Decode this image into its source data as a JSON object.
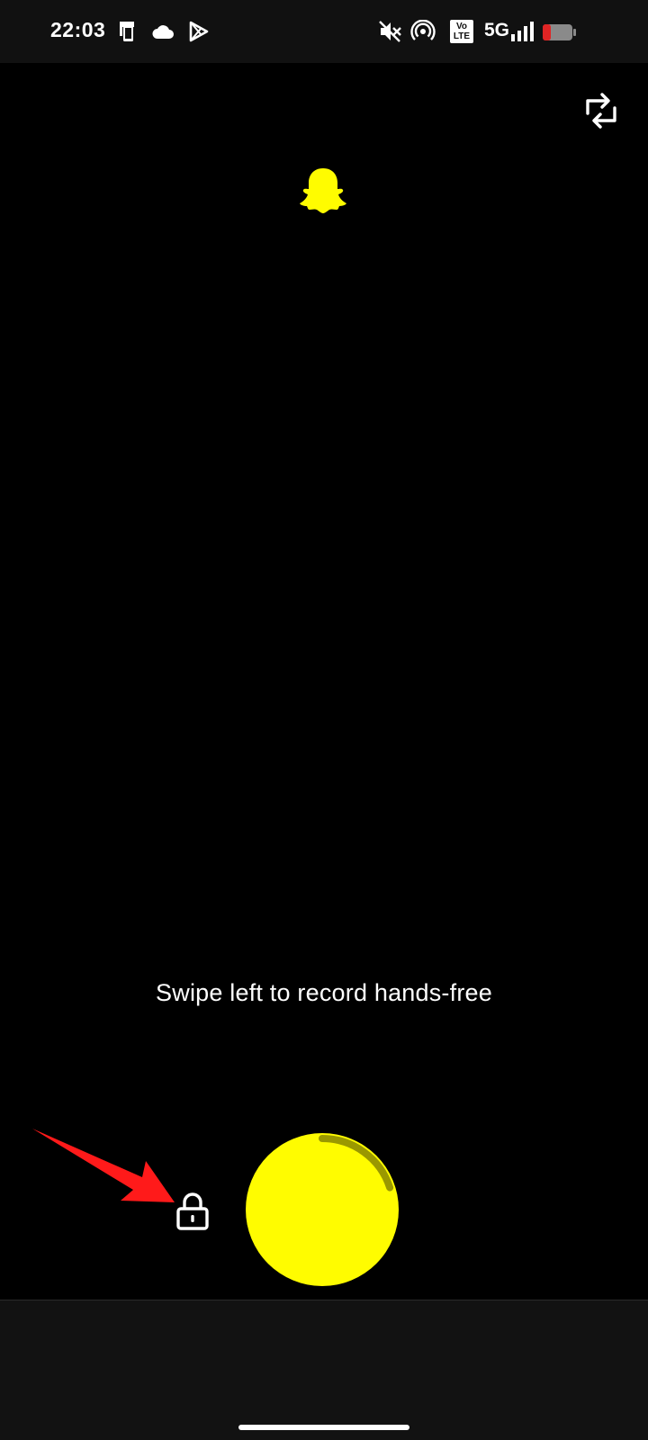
{
  "status_bar": {
    "time": "22:03",
    "icons": [
      "notification-phone-icon",
      "cloud-icon",
      "play-store-icon",
      "mute-icon",
      "hotspot-icon",
      "volte-icon",
      "signal-icon",
      "battery-low-icon"
    ],
    "volte_line1": "Vo",
    "volte_line2": "LTE",
    "network": "5G"
  },
  "camera": {
    "hint": "Swipe left to record hands-free",
    "capture_color": "#FFFC00",
    "progress_color": "#9A9800",
    "recording_progress_fraction": 0.2
  },
  "colors": {
    "background": "#000000",
    "brand_yellow": "#FFFC00",
    "annotation_red": "#FF1A1A",
    "bottom_bar": "#121212"
  }
}
